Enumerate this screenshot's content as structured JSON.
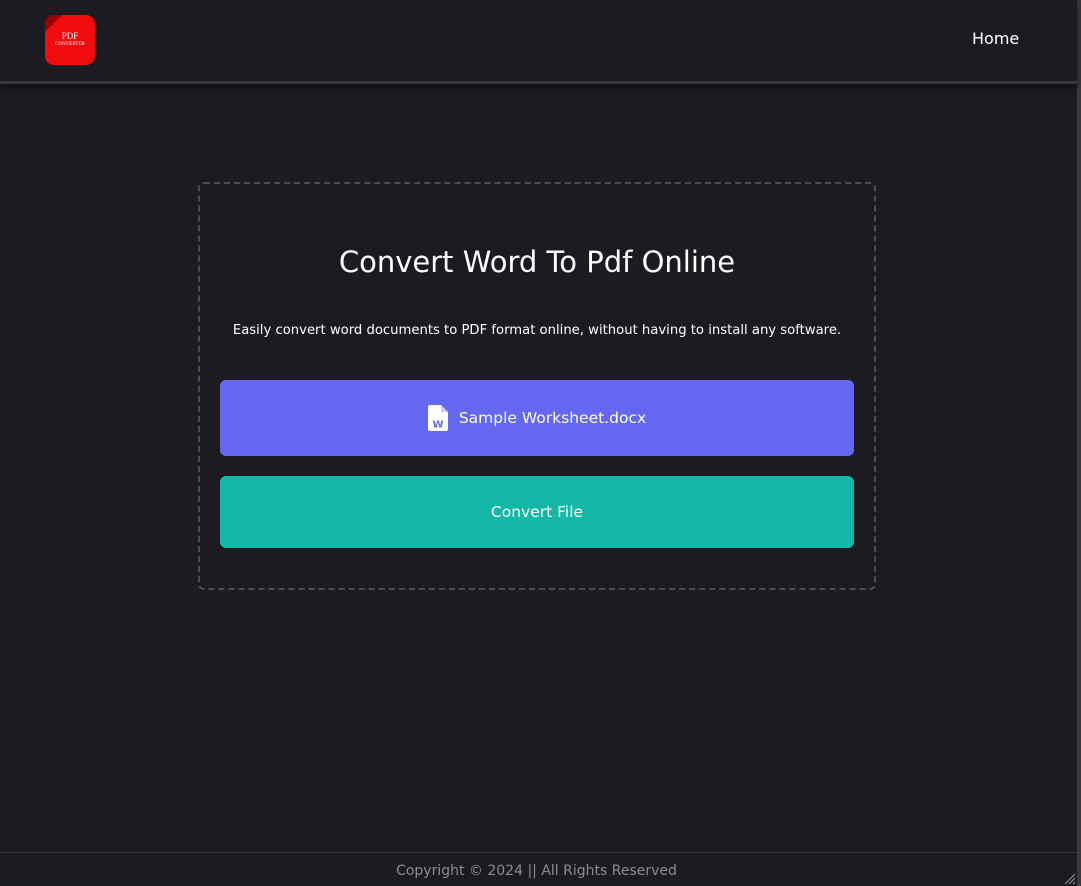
{
  "header": {
    "logo": {
      "line1": "PDF",
      "line2": "CONVERTER"
    },
    "nav": {
      "home_label": "Home"
    }
  },
  "main": {
    "title": "Convert Word To Pdf Online",
    "subtitle": "Easily convert word documents to PDF format online, without having to install any software.",
    "file_button": {
      "icon": "word-document-icon",
      "filename": "Sample Worksheet.docx"
    },
    "convert_button_label": "Convert File"
  },
  "footer": {
    "copyright": "Copyright © 2024 || All Rights Reserved"
  },
  "colors": {
    "background": "#1c1b21",
    "logo": "#f00c0c",
    "file_button": "#6467f0",
    "convert_button": "#14b8a6",
    "footer_text": "#8c8b91"
  }
}
